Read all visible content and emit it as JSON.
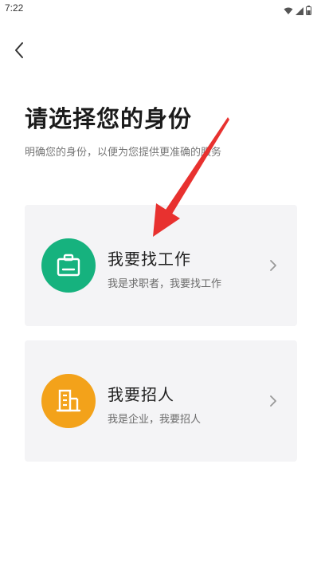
{
  "status_bar": {
    "time": "7:22",
    "icons": [
      "wifi-icon",
      "signal-icon",
      "battery-icon"
    ]
  },
  "nav": {
    "back_icon": "chevron-left-icon"
  },
  "header": {
    "title": "请选择您的身份",
    "subtitle": "明确您的身份，以便为您提供更准确的服务"
  },
  "roles": [
    {
      "title": "我要找工作",
      "description": "我是求职者，我要找工作",
      "icon": "briefcase-icon",
      "color": "#16b27e"
    },
    {
      "title": "我要招人",
      "description": "我是企业，我要招人",
      "icon": "building-icon",
      "color": "#f3a21a"
    }
  ],
  "annotation": {
    "arrow_color": "#e8312f"
  }
}
